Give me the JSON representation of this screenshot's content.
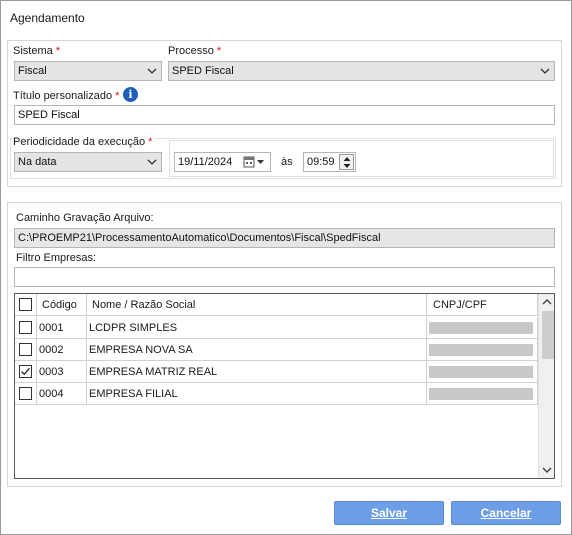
{
  "window": {
    "title": "Agendamento"
  },
  "top": {
    "sistema": {
      "label": "Sistema",
      "required": "*",
      "value": "Fiscal"
    },
    "processo": {
      "label": "Processo",
      "required": "*",
      "value": "SPED Fiscal"
    },
    "titulo": {
      "label": "Título personalizado",
      "required": "*",
      "value": "SPED Fiscal",
      "info_icon": "info-icon"
    },
    "periodicidade": {
      "label": "Periodicidade da execução",
      "required": "*",
      "value": "Na data"
    },
    "date": {
      "value": "19/11/2024",
      "icon": "calendar-icon"
    },
    "time_sep": "às",
    "time": {
      "value": "09:59"
    }
  },
  "path": {
    "label": "Caminho Gravação Arquivo:",
    "value": "C:\\PROEMP21\\ProcessamentoAutomatico\\Documentos\\Fiscal\\SpedFiscal"
  },
  "filter": {
    "label": "Filtro Empresas:",
    "value": ""
  },
  "table": {
    "columns": [
      "Código",
      "Nome / Razão Social",
      "CNPJ/CPF"
    ],
    "rows": [
      {
        "checked": false,
        "codigo": "0001",
        "nome": "LCDPR SIMPLES",
        "cnpj": ""
      },
      {
        "checked": false,
        "codigo": "0002",
        "nome": "EMPRESA NOVA SA",
        "cnpj": ""
      },
      {
        "checked": true,
        "codigo": "0003",
        "nome": "EMPRESA MATRIZ REAL",
        "cnpj": ""
      },
      {
        "checked": false,
        "codigo": "0004",
        "nome": "EMPRESA FILIAL",
        "cnpj": ""
      }
    ]
  },
  "buttons": {
    "save": "Salvar",
    "cancel": "Cancelar"
  },
  "colors": {
    "button": "#6d9ee8",
    "required": "#dd1111",
    "info": "#1f5fb8"
  }
}
